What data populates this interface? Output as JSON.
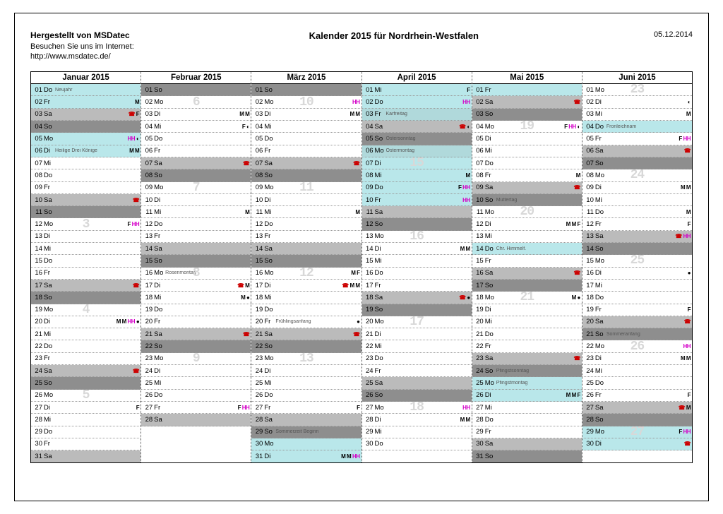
{
  "header": {
    "brand": "Hergestellt von MSDatec",
    "sub1": "Besuchen Sie uns im Internet:",
    "sub2": "http://www.msdatec.de/",
    "title": "Kalender 2015 für Nordrhein-Westfalen",
    "date": "05.12.2014"
  },
  "months": [
    {
      "name": "Januar 2015",
      "days": [
        {
          "n": "01",
          "w": "Do",
          "note": "Neujahr",
          "bg": "hol",
          "mk": ""
        },
        {
          "n": "02",
          "w": "Fr",
          "bg": "hol",
          "mk": "M",
          "wk": ""
        },
        {
          "n": "03",
          "w": "Sa",
          "bg": "sat",
          "mk": "☎ F"
        },
        {
          "n": "04",
          "w": "So",
          "bg": "sun",
          "mk": ""
        },
        {
          "n": "05",
          "w": "Mo",
          "bg": "hol",
          "mk": "HH ◐",
          "wk": ""
        },
        {
          "n": "06",
          "w": "Di",
          "note": "Heilige Drei Könige",
          "bg": "hol",
          "mk": "M M"
        },
        {
          "n": "07",
          "w": "Mi",
          "mk": ""
        },
        {
          "n": "08",
          "w": "Do",
          "mk": ""
        },
        {
          "n": "09",
          "w": "Fr",
          "mk": ""
        },
        {
          "n": "10",
          "w": "Sa",
          "bg": "sat",
          "mk": "☎"
        },
        {
          "n": "11",
          "w": "So",
          "bg": "sun",
          "mk": ""
        },
        {
          "n": "12",
          "w": "Mo",
          "mk": "F HH",
          "wk": "3"
        },
        {
          "n": "13",
          "w": "Di",
          "mk": ""
        },
        {
          "n": "14",
          "w": "Mi",
          "mk": ""
        },
        {
          "n": "15",
          "w": "Do",
          "mk": ""
        },
        {
          "n": "16",
          "w": "Fr",
          "mk": ""
        },
        {
          "n": "17",
          "w": "Sa",
          "bg": "sat",
          "mk": "☎"
        },
        {
          "n": "18",
          "w": "So",
          "bg": "sun",
          "mk": ""
        },
        {
          "n": "19",
          "w": "Mo",
          "mk": "",
          "wk": "4"
        },
        {
          "n": "20",
          "w": "Di",
          "mk": "M M HH ●"
        },
        {
          "n": "21",
          "w": "Mi",
          "mk": ""
        },
        {
          "n": "22",
          "w": "Do",
          "mk": ""
        },
        {
          "n": "23",
          "w": "Fr",
          "mk": ""
        },
        {
          "n": "24",
          "w": "Sa",
          "bg": "sat",
          "mk": "☎"
        },
        {
          "n": "25",
          "w": "So",
          "bg": "sun",
          "mk": ""
        },
        {
          "n": "26",
          "w": "Mo",
          "mk": "",
          "wk": "5"
        },
        {
          "n": "27",
          "w": "Di",
          "mk": "F"
        },
        {
          "n": "28",
          "w": "Mi",
          "mk": ""
        },
        {
          "n": "29",
          "w": "Do",
          "mk": ""
        },
        {
          "n": "30",
          "w": "Fr",
          "mk": ""
        },
        {
          "n": "31",
          "w": "Sa",
          "bg": "sat",
          "mk": ""
        }
      ]
    },
    {
      "name": "Februar 2015",
      "days": [
        {
          "n": "01",
          "w": "So",
          "bg": "sun",
          "mk": ""
        },
        {
          "n": "02",
          "w": "Mo",
          "mk": "",
          "wk": "6"
        },
        {
          "n": "03",
          "w": "Di",
          "mk": "M M"
        },
        {
          "n": "04",
          "w": "Mi",
          "mk": "F ◐"
        },
        {
          "n": "05",
          "w": "Do",
          "mk": ""
        },
        {
          "n": "06",
          "w": "Fr",
          "mk": ""
        },
        {
          "n": "07",
          "w": "Sa",
          "bg": "sat",
          "mk": "☎"
        },
        {
          "n": "08",
          "w": "So",
          "bg": "sun",
          "mk": ""
        },
        {
          "n": "09",
          "w": "Mo",
          "mk": "",
          "wk": "7"
        },
        {
          "n": "10",
          "w": "Di",
          "mk": ""
        },
        {
          "n": "11",
          "w": "Mi",
          "mk": "M"
        },
        {
          "n": "12",
          "w": "Do",
          "mk": ""
        },
        {
          "n": "13",
          "w": "Fr",
          "mk": ""
        },
        {
          "n": "14",
          "w": "Sa",
          "bg": "sat",
          "mk": ""
        },
        {
          "n": "15",
          "w": "So",
          "bg": "sun",
          "mk": ""
        },
        {
          "n": "16",
          "w": "Mo",
          "note": "Rosenmontag",
          "mk": "",
          "wk": "8"
        },
        {
          "n": "17",
          "w": "Di",
          "mk": "☎ M"
        },
        {
          "n": "18",
          "w": "Mi",
          "mk": "M ●"
        },
        {
          "n": "19",
          "w": "Do",
          "mk": ""
        },
        {
          "n": "20",
          "w": "Fr",
          "mk": ""
        },
        {
          "n": "21",
          "w": "Sa",
          "bg": "sat",
          "mk": "☎"
        },
        {
          "n": "22",
          "w": "So",
          "bg": "sun",
          "mk": ""
        },
        {
          "n": "23",
          "w": "Mo",
          "mk": "",
          "wk": "9"
        },
        {
          "n": "24",
          "w": "Di",
          "mk": ""
        },
        {
          "n": "25",
          "w": "Mi",
          "mk": ""
        },
        {
          "n": "26",
          "w": "Do",
          "mk": ""
        },
        {
          "n": "27",
          "w": "Fr",
          "mk": "F HH"
        },
        {
          "n": "28",
          "w": "Sa",
          "bg": "sat",
          "mk": ""
        }
      ]
    },
    {
      "name": "März 2015",
      "days": [
        {
          "n": "01",
          "w": "So",
          "bg": "sun",
          "mk": ""
        },
        {
          "n": "02",
          "w": "Mo",
          "mk": "HH",
          "wk": "10"
        },
        {
          "n": "03",
          "w": "Di",
          "mk": "M M"
        },
        {
          "n": "04",
          "w": "Mi",
          "mk": ""
        },
        {
          "n": "05",
          "w": "Do",
          "mk": ""
        },
        {
          "n": "06",
          "w": "Fr",
          "mk": ""
        },
        {
          "n": "07",
          "w": "Sa",
          "bg": "sat",
          "mk": "☎"
        },
        {
          "n": "08",
          "w": "So",
          "bg": "sun",
          "mk": ""
        },
        {
          "n": "09",
          "w": "Mo",
          "mk": "",
          "wk": "11"
        },
        {
          "n": "10",
          "w": "Di",
          "mk": ""
        },
        {
          "n": "11",
          "w": "Mi",
          "mk": "M"
        },
        {
          "n": "12",
          "w": "Do",
          "mk": ""
        },
        {
          "n": "13",
          "w": "Fr",
          "mk": ""
        },
        {
          "n": "14",
          "w": "Sa",
          "bg": "sat",
          "mk": ""
        },
        {
          "n": "15",
          "w": "So",
          "bg": "sun",
          "mk": ""
        },
        {
          "n": "16",
          "w": "Mo",
          "mk": "M F",
          "wk": "12"
        },
        {
          "n": "17",
          "w": "Di",
          "mk": "☎ M M"
        },
        {
          "n": "18",
          "w": "Mi",
          "mk": ""
        },
        {
          "n": "19",
          "w": "Do",
          "mk": ""
        },
        {
          "n": "20",
          "w": "Fr",
          "note": "Frühlingsanfang",
          "mk": "●"
        },
        {
          "n": "21",
          "w": "Sa",
          "bg": "sat",
          "mk": "☎"
        },
        {
          "n": "22",
          "w": "So",
          "bg": "sun",
          "mk": ""
        },
        {
          "n": "23",
          "w": "Mo",
          "mk": "",
          "wk": "13"
        },
        {
          "n": "24",
          "w": "Di",
          "mk": ""
        },
        {
          "n": "25",
          "w": "Mi",
          "mk": ""
        },
        {
          "n": "26",
          "w": "Do",
          "mk": ""
        },
        {
          "n": "27",
          "w": "Fr",
          "mk": "F"
        },
        {
          "n": "28",
          "w": "Sa",
          "bg": "sat",
          "mk": ""
        },
        {
          "n": "29",
          "w": "So",
          "bg": "sun",
          "note": "Sommerzeit Beginn",
          "mk": ""
        },
        {
          "n": "30",
          "w": "Mo",
          "bg": "hol",
          "mk": "",
          "wk": ""
        },
        {
          "n": "31",
          "w": "Di",
          "bg": "hol",
          "mk": "M M HH"
        }
      ]
    },
    {
      "name": "April 2015",
      "days": [
        {
          "n": "01",
          "w": "Mi",
          "bg": "hol",
          "mk": "F"
        },
        {
          "n": "02",
          "w": "Do",
          "bg": "hol",
          "mk": "HH"
        },
        {
          "n": "03",
          "w": "Fr",
          "note": "Karfreitag",
          "bg": "hol2",
          "mk": ""
        },
        {
          "n": "04",
          "w": "Sa",
          "bg": "sat",
          "mk": "☎ ◐"
        },
        {
          "n": "05",
          "w": "So",
          "note": "Ostersonntag",
          "bg": "sun",
          "mk": ""
        },
        {
          "n": "06",
          "w": "Mo",
          "note": "Ostermontag",
          "bg": "hol2",
          "mk": ""
        },
        {
          "n": "07",
          "w": "Di",
          "bg": "hol",
          "mk": "",
          "wk": "15"
        },
        {
          "n": "08",
          "w": "Mi",
          "bg": "hol",
          "mk": "M"
        },
        {
          "n": "09",
          "w": "Do",
          "bg": "hol",
          "mk": "F HH"
        },
        {
          "n": "10",
          "w": "Fr",
          "bg": "hol",
          "mk": "HH"
        },
        {
          "n": "11",
          "w": "Sa",
          "bg": "sat",
          "mk": ""
        },
        {
          "n": "12",
          "w": "So",
          "bg": "sun",
          "mk": ""
        },
        {
          "n": "13",
          "w": "Mo",
          "mk": "",
          "wk": "16"
        },
        {
          "n": "14",
          "w": "Di",
          "mk": "M M"
        },
        {
          "n": "15",
          "w": "Mi",
          "mk": ""
        },
        {
          "n": "16",
          "w": "Do",
          "mk": ""
        },
        {
          "n": "17",
          "w": "Fr",
          "mk": ""
        },
        {
          "n": "18",
          "w": "Sa",
          "bg": "sat",
          "mk": "☎ ●"
        },
        {
          "n": "19",
          "w": "So",
          "bg": "sun",
          "mk": ""
        },
        {
          "n": "20",
          "w": "Mo",
          "mk": "",
          "wk": "17"
        },
        {
          "n": "21",
          "w": "Di",
          "mk": ""
        },
        {
          "n": "22",
          "w": "Mi",
          "mk": ""
        },
        {
          "n": "23",
          "w": "Do",
          "mk": ""
        },
        {
          "n": "24",
          "w": "Fr",
          "mk": ""
        },
        {
          "n": "25",
          "w": "Sa",
          "bg": "sat",
          "mk": ""
        },
        {
          "n": "26",
          "w": "So",
          "bg": "sun",
          "mk": ""
        },
        {
          "n": "27",
          "w": "Mo",
          "mk": "HH",
          "wk": "18"
        },
        {
          "n": "28",
          "w": "Di",
          "mk": "M M"
        },
        {
          "n": "29",
          "w": "Mi",
          "mk": ""
        },
        {
          "n": "30",
          "w": "Do",
          "mk": ""
        }
      ]
    },
    {
      "name": "Mai 2015",
      "days": [
        {
          "n": "01",
          "w": "Fr",
          "bg": "hol",
          "mk": ""
        },
        {
          "n": "02",
          "w": "Sa",
          "bg": "sat",
          "mk": "☎"
        },
        {
          "n": "03",
          "w": "So",
          "bg": "sun",
          "mk": ""
        },
        {
          "n": "04",
          "w": "Mo",
          "mk": "F HH ◐",
          "wk": "19"
        },
        {
          "n": "05",
          "w": "Di",
          "mk": ""
        },
        {
          "n": "06",
          "w": "Mi",
          "mk": ""
        },
        {
          "n": "07",
          "w": "Do",
          "mk": ""
        },
        {
          "n": "08",
          "w": "Fr",
          "mk": "M"
        },
        {
          "n": "09",
          "w": "Sa",
          "bg": "sat",
          "mk": "☎"
        },
        {
          "n": "10",
          "w": "So",
          "note": "Muttertag",
          "bg": "sun",
          "mk": ""
        },
        {
          "n": "11",
          "w": "Mo",
          "mk": "",
          "wk": "20"
        },
        {
          "n": "12",
          "w": "Di",
          "mk": "M M F"
        },
        {
          "n": "13",
          "w": "Mi",
          "mk": ""
        },
        {
          "n": "14",
          "w": "Do",
          "note": "Chr. Himmelf.",
          "bg": "hol",
          "mk": ""
        },
        {
          "n": "15",
          "w": "Fr",
          "mk": ""
        },
        {
          "n": "16",
          "w": "Sa",
          "bg": "sat",
          "mk": "☎"
        },
        {
          "n": "17",
          "w": "So",
          "bg": "sun",
          "mk": ""
        },
        {
          "n": "18",
          "w": "Mo",
          "mk": "M ●",
          "wk": "21"
        },
        {
          "n": "19",
          "w": "Di",
          "mk": ""
        },
        {
          "n": "20",
          "w": "Mi",
          "mk": ""
        },
        {
          "n": "21",
          "w": "Do",
          "mk": ""
        },
        {
          "n": "22",
          "w": "Fr",
          "mk": ""
        },
        {
          "n": "23",
          "w": "Sa",
          "bg": "sat",
          "mk": "☎"
        },
        {
          "n": "24",
          "w": "So",
          "note": "Pfingstsonntag",
          "bg": "sun",
          "mk": ""
        },
        {
          "n": "25",
          "w": "Mo",
          "note": "Pfingstmontag",
          "bg": "hol",
          "mk": ""
        },
        {
          "n": "26",
          "w": "Di",
          "bg": "hol",
          "mk": "M M F",
          "wk": ""
        },
        {
          "n": "27",
          "w": "Mi",
          "mk": ""
        },
        {
          "n": "28",
          "w": "Do",
          "mk": ""
        },
        {
          "n": "29",
          "w": "Fr",
          "mk": ""
        },
        {
          "n": "30",
          "w": "Sa",
          "bg": "sat",
          "mk": ""
        },
        {
          "n": "31",
          "w": "So",
          "bg": "sun",
          "mk": ""
        }
      ]
    },
    {
      "name": "Juni 2015",
      "days": [
        {
          "n": "01",
          "w": "Mo",
          "mk": "",
          "wk": "23"
        },
        {
          "n": "02",
          "w": "Di",
          "mk": "◐"
        },
        {
          "n": "03",
          "w": "Mi",
          "mk": "M"
        },
        {
          "n": "04",
          "w": "Do",
          "note": "Fronleichnam",
          "bg": "hol",
          "mk": ""
        },
        {
          "n": "05",
          "w": "Fr",
          "mk": "F HH"
        },
        {
          "n": "06",
          "w": "Sa",
          "bg": "sat",
          "mk": "☎"
        },
        {
          "n": "07",
          "w": "So",
          "bg": "sun",
          "mk": ""
        },
        {
          "n": "08",
          "w": "Mo",
          "mk": "",
          "wk": "24"
        },
        {
          "n": "09",
          "w": "Di",
          "mk": "M M"
        },
        {
          "n": "10",
          "w": "Mi",
          "mk": ""
        },
        {
          "n": "11",
          "w": "Do",
          "mk": "M"
        },
        {
          "n": "12",
          "w": "Fr",
          "mk": "F"
        },
        {
          "n": "13",
          "w": "Sa",
          "bg": "sat",
          "mk": "☎ HH"
        },
        {
          "n": "14",
          "w": "So",
          "bg": "sun",
          "mk": ""
        },
        {
          "n": "15",
          "w": "Mo",
          "mk": "",
          "wk": "25"
        },
        {
          "n": "16",
          "w": "Di",
          "mk": "●"
        },
        {
          "n": "17",
          "w": "Mi",
          "mk": ""
        },
        {
          "n": "18",
          "w": "Do",
          "mk": ""
        },
        {
          "n": "19",
          "w": "Fr",
          "mk": "F"
        },
        {
          "n": "20",
          "w": "Sa",
          "bg": "sat",
          "mk": "☎"
        },
        {
          "n": "21",
          "w": "So",
          "note": "Sommeranfang",
          "bg": "sun",
          "mk": ""
        },
        {
          "n": "22",
          "w": "Mo",
          "mk": "HH",
          "wk": "26"
        },
        {
          "n": "23",
          "w": "Di",
          "mk": "M M"
        },
        {
          "n": "24",
          "w": "Mi",
          "mk": ""
        },
        {
          "n": "25",
          "w": "Do",
          "mk": ""
        },
        {
          "n": "26",
          "w": "Fr",
          "mk": "F"
        },
        {
          "n": "27",
          "w": "Sa",
          "bg": "sat",
          "mk": "☎ M"
        },
        {
          "n": "28",
          "w": "So",
          "bg": "sun",
          "mk": ""
        },
        {
          "n": "29",
          "w": "Mo",
          "bg": "hol",
          "mk": "F HH",
          "wk": "27"
        },
        {
          "n": "30",
          "w": "Di",
          "bg": "hol",
          "mk": "☎"
        }
      ]
    }
  ]
}
